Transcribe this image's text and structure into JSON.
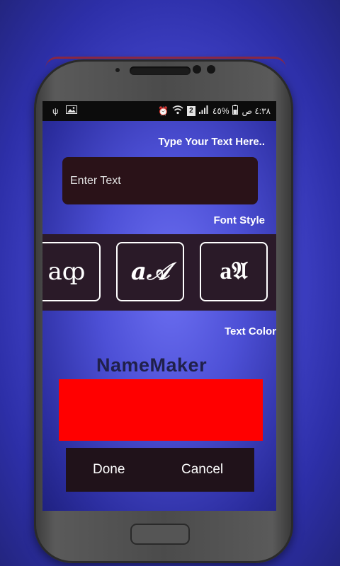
{
  "status_bar": {
    "left_icons": [
      "usb-icon",
      "image-icon"
    ],
    "right_icons": [
      "alarm-icon",
      "wifi-icon",
      "signal-icon"
    ],
    "sim_label": "2",
    "battery_text": "٤٥%",
    "time": "٤:٣٨ ص"
  },
  "text_section": {
    "heading": "Type Your Text Here..",
    "placeholder": "Enter Text"
  },
  "font_section": {
    "heading": "Font Style",
    "styles": [
      "aȹ",
      "a𝒜",
      "a𝔄"
    ]
  },
  "color_section": {
    "heading": "Text Color",
    "preview_text": "NameMaker",
    "selected_color": "#ff0000"
  },
  "actions": {
    "done_label": "Done",
    "cancel_label": "Cancel"
  }
}
